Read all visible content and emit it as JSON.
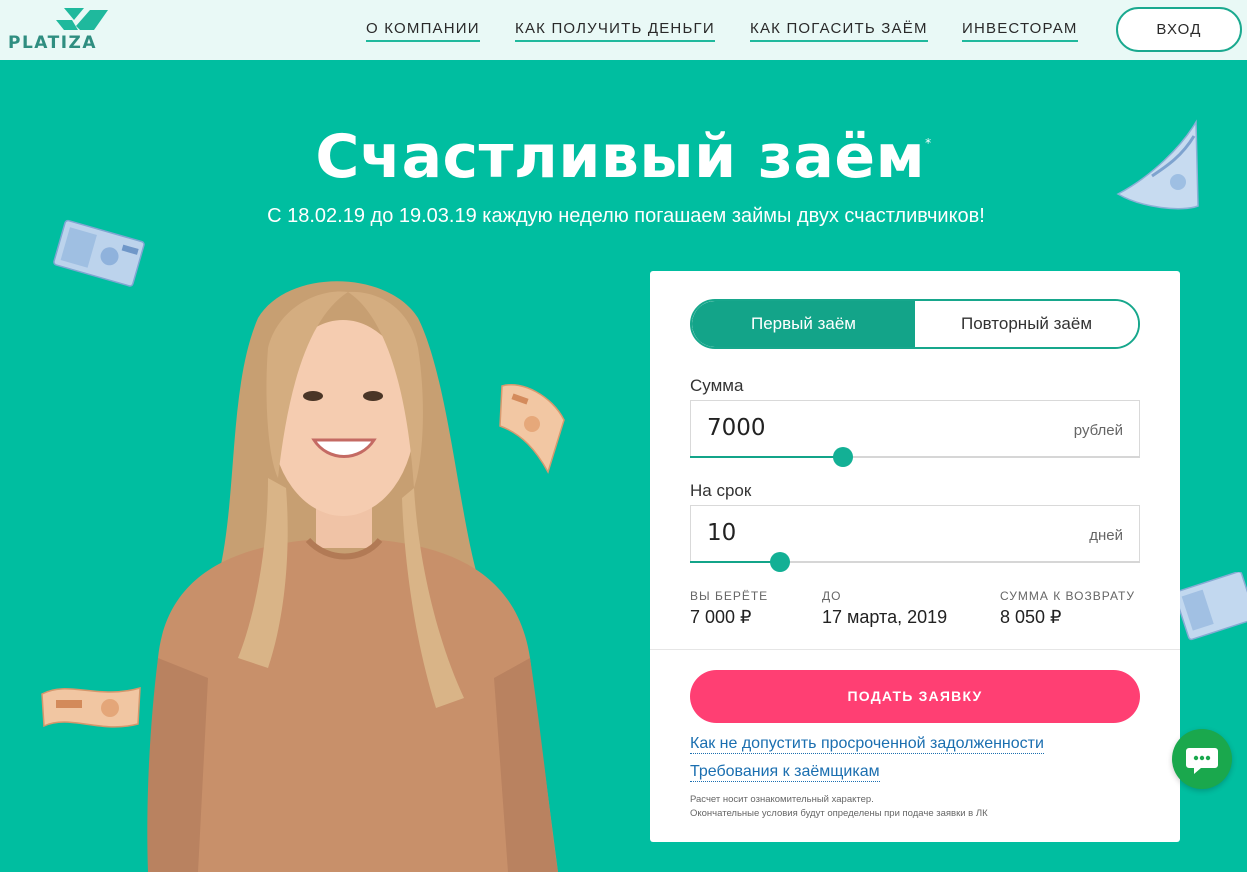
{
  "brand": {
    "name": "PLATIZA"
  },
  "nav": {
    "items": [
      {
        "label": "О КОМПАНИИ"
      },
      {
        "label": "КАК ПОЛУЧИТЬ ДЕНЬГИ"
      },
      {
        "label": "КАК ПОГАСИТЬ ЗАЁМ"
      },
      {
        "label": "ИНВЕСТОРАМ"
      }
    ],
    "login_label": "ВХОД"
  },
  "hero": {
    "title": "Счастливый заём",
    "title_mark": "*",
    "subtitle": "С 18.02.19 до 19.03.19 каждую неделю погашаем займы двух счастливчиков!"
  },
  "calculator": {
    "tabs": [
      {
        "label": "Первый заём",
        "active": true
      },
      {
        "label": "Повторный заём",
        "active": false
      }
    ],
    "amount": {
      "label": "Сумма",
      "value": "7000",
      "unit": "рублей",
      "slider_fraction": 0.34
    },
    "term": {
      "label": "На срок",
      "value": "10",
      "unit": "дней",
      "slider_fraction": 0.2
    },
    "summary": [
      {
        "label": "ВЫ БЕРЁТЕ",
        "value": "7 000 ₽"
      },
      {
        "label": "ДО",
        "value": "17 марта, 2019"
      },
      {
        "label": "СУММА К ВОЗВРАТУ",
        "value": "8 050 ₽"
      }
    ],
    "submit_label": "ПОДАТЬ ЗАЯВКУ",
    "links": [
      {
        "label": "Как не допустить просроченной задолженности"
      },
      {
        "label": "Требования к заёмщикам"
      }
    ],
    "disclaimer": [
      "Расчет носит ознакомительный характер.",
      "Окончательные условия будут определены при подаче заявки в ЛК"
    ]
  },
  "colors": {
    "brand_green": "#00bea0",
    "accent_teal": "#13a489",
    "submit_pink": "#ff3f73",
    "chat_green": "#1aa84d",
    "link_blue": "#1b6fb0"
  },
  "icons": {
    "chat": "chat-bubble-icon",
    "logo_mark": "platiza-logo-icon"
  }
}
